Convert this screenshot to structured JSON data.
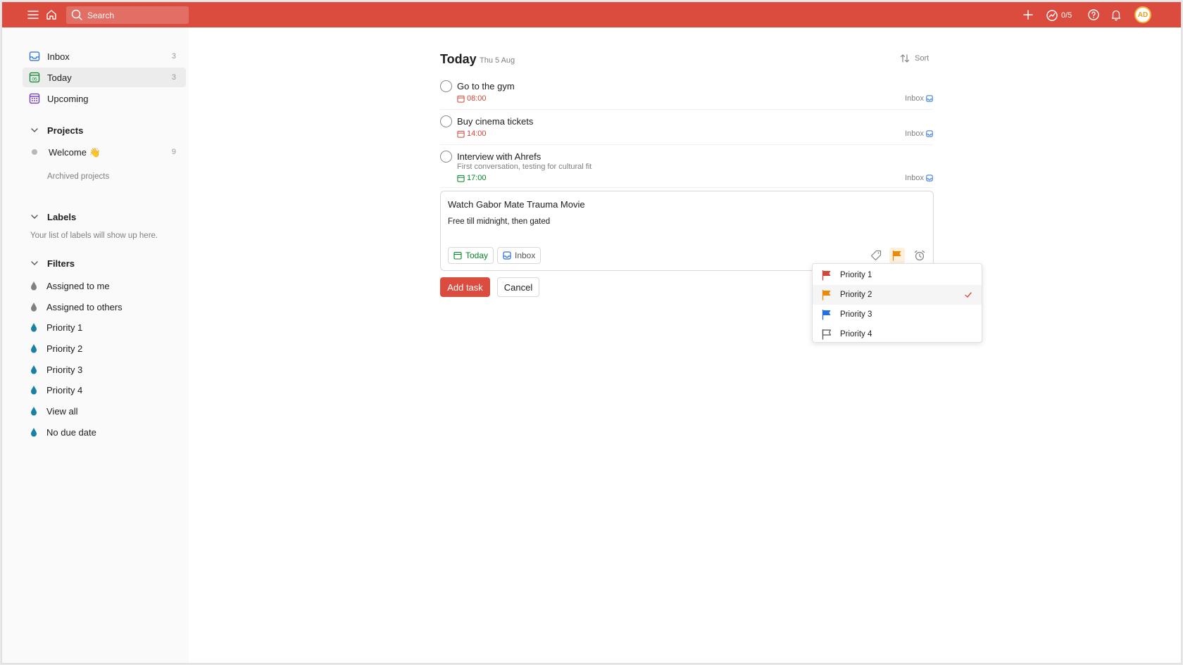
{
  "topbar": {
    "search_placeholder": "Search",
    "karma": "0/5",
    "avatar": "AD"
  },
  "sidebar": {
    "nav": [
      {
        "label": "Inbox",
        "count": "3"
      },
      {
        "label": "Today",
        "count": "3",
        "icon_text": "05"
      },
      {
        "label": "Upcoming",
        "count": ""
      }
    ],
    "projects": {
      "title": "Projects",
      "items": [
        {
          "label": "Welcome 👋",
          "count": "9"
        }
      ],
      "archived": "Archived projects"
    },
    "labels": {
      "title": "Labels",
      "empty": "Your list of labels will show up here."
    },
    "filters": {
      "title": "Filters",
      "items": [
        "Assigned to me",
        "Assigned to others",
        "Priority 1",
        "Priority 2",
        "Priority 3",
        "Priority 4",
        "View all",
        "No due date"
      ]
    }
  },
  "main": {
    "title": "Today",
    "date": "Thu 5 Aug",
    "sort": "Sort",
    "tasks": [
      {
        "name": "Go to the gym",
        "description": "",
        "time": "08:00",
        "project": "Inbox"
      },
      {
        "name": "Buy cinema tickets",
        "description": "",
        "time": "14:00",
        "project": "Inbox"
      },
      {
        "name": "Interview with Ahrefs",
        "description": "First conversation, testing for cultural fit",
        "time": "17:00",
        "project": "Inbox"
      }
    ],
    "editor": {
      "name": "Watch Gabor Mate Trauma Movie",
      "description": "Free till midnight, then gated",
      "due_chip": "Today",
      "project_chip": "Inbox"
    },
    "add_button": "Add task",
    "cancel_button": "Cancel"
  },
  "priority_menu": {
    "items": [
      "Priority 1",
      "Priority 2",
      "Priority 3",
      "Priority 4"
    ],
    "selected": "Priority 2"
  },
  "colors": {
    "brand": "#db4c3f",
    "p1": "#d1453b",
    "p2": "#eb8909",
    "p3": "#246fe0",
    "today_green": "#058527",
    "overdue_red": "#d1453b",
    "filter_teal": "#1b7fa8",
    "filter_gray": "#808080"
  }
}
